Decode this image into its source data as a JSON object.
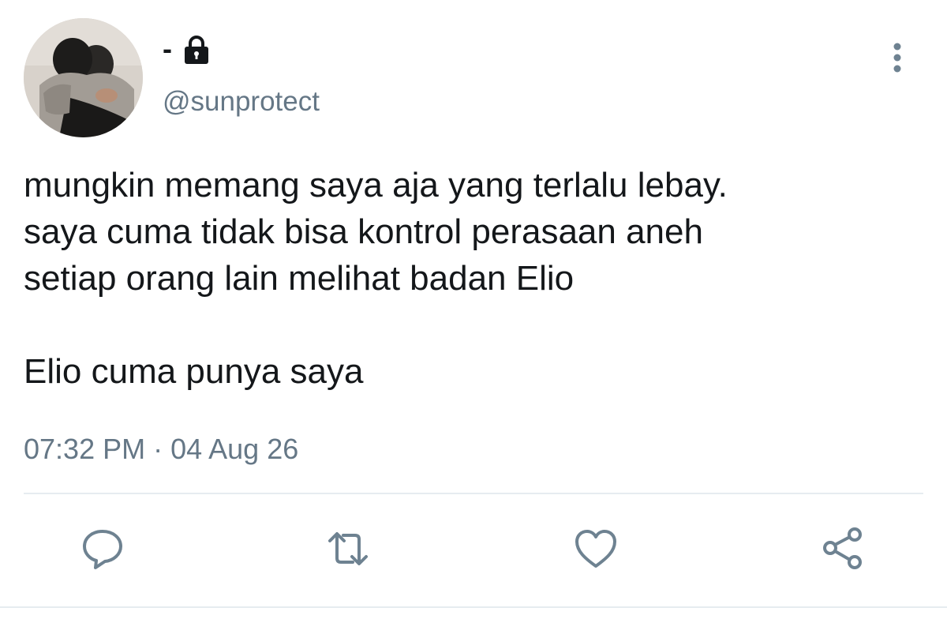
{
  "header": {
    "display_name": "-",
    "handle": "@sunprotect",
    "lock_icon": "lock-icon",
    "more_icon": "more-vertical-icon"
  },
  "tweet": {
    "lines": [
      "mungkin memang saya aja yang terlalu lebay.",
      "saya cuma tidak bisa kontrol perasaan aneh",
      "setiap orang lain melihat badan Elio",
      "",
      "Elio cuma punya saya"
    ],
    "timestamp": "07:32 PM · 04 Aug 26"
  },
  "actions": [
    {
      "name": "reply",
      "icon": "comment-icon"
    },
    {
      "name": "retweet",
      "icon": "retweet-icon"
    },
    {
      "name": "like",
      "icon": "heart-icon"
    },
    {
      "name": "share",
      "icon": "share-icon"
    }
  ],
  "colors": {
    "text": "#14171a",
    "secondary": "#657786",
    "icon": "#6e8291",
    "divider": "#e6ecf0"
  }
}
